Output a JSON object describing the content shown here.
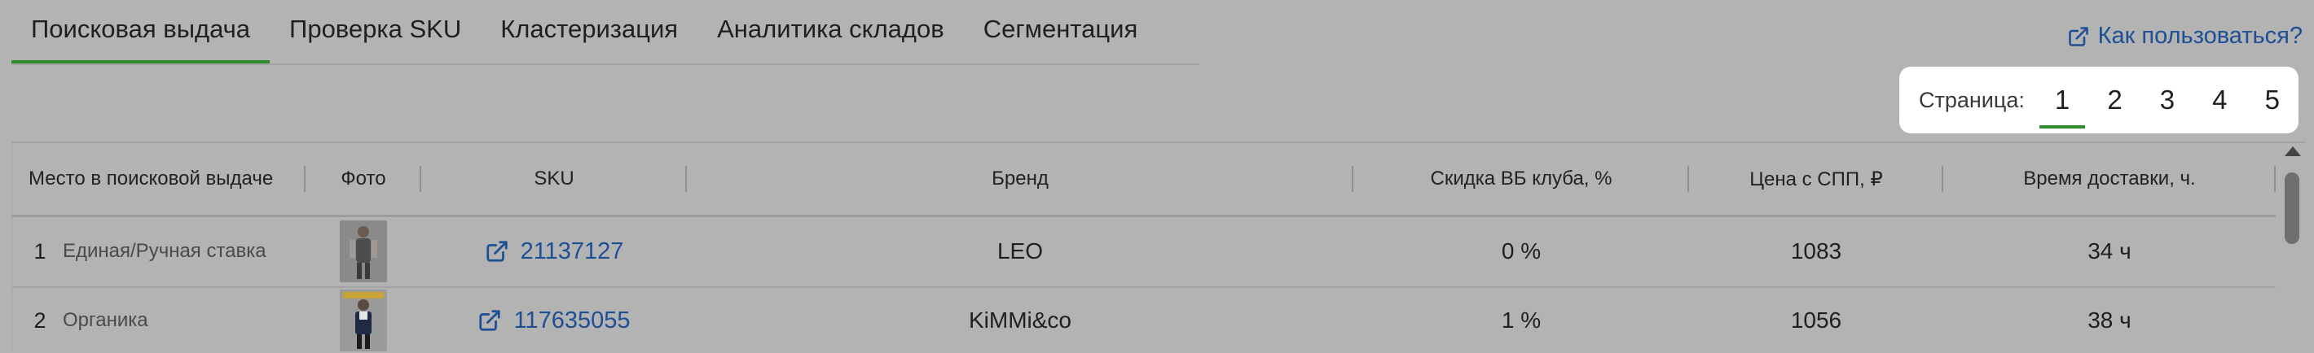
{
  "tabs": [
    {
      "label": "Поисковая выдача",
      "active": true
    },
    {
      "label": "Проверка SKU"
    },
    {
      "label": "Кластеризация"
    },
    {
      "label": "Аналитика складов"
    },
    {
      "label": "Сегментация"
    }
  ],
  "help_link": {
    "label": "Как пользоваться?",
    "icon": "external-link-icon"
  },
  "pagination": {
    "label": "Страница:",
    "pages": [
      "1",
      "2",
      "3",
      "4",
      "5"
    ],
    "current": "1"
  },
  "table": {
    "columns": [
      "Место в поисковой выдаче",
      "Фото",
      "SKU",
      "Бренд",
      "Скидка ВБ клуба, %",
      "Цена с СПП, ₽",
      "Время доставки, ч."
    ],
    "rows": [
      {
        "place": "1",
        "placement_type": "Единая/Ручная ставка",
        "sku": "21137127",
        "brand": "LEO",
        "discount": "0 %",
        "price": "1083",
        "delivery": "34 ч"
      },
      {
        "place": "2",
        "placement_type": "Органика",
        "sku": "117635055",
        "brand": "KiMMi&co",
        "discount": "1 %",
        "price": "1056",
        "delivery": "38 ч"
      }
    ]
  },
  "colors": {
    "accent": "#2e8b2e",
    "link": "#1d4f94",
    "background": "#b3b3b3"
  }
}
